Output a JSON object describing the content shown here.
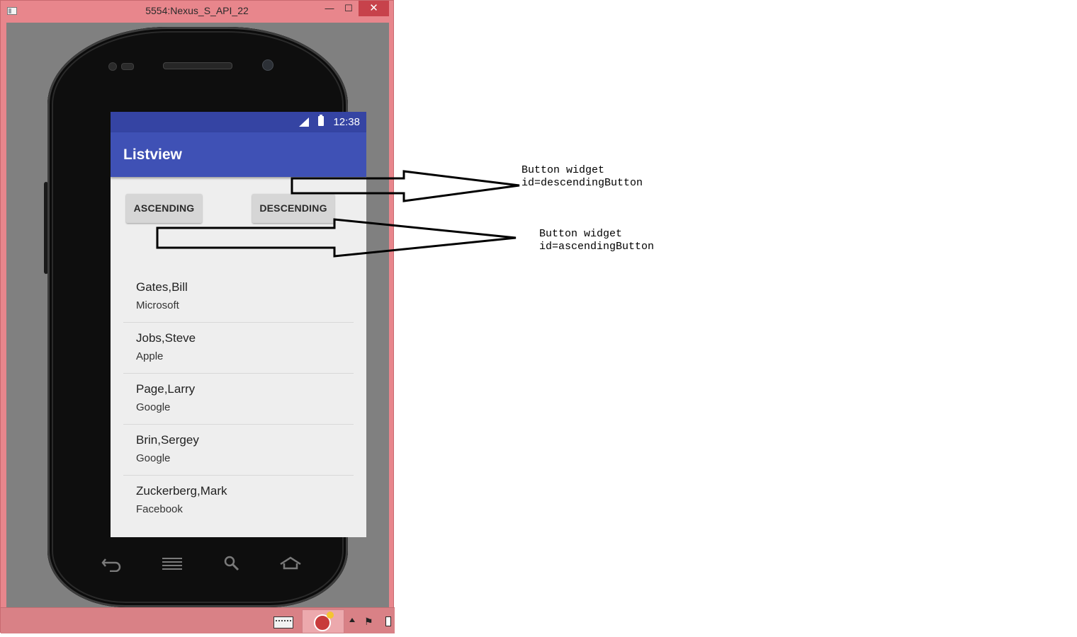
{
  "window": {
    "title": "5554:Nexus_S_API_22",
    "min_glyph": "—",
    "max_glyph": "☐",
    "close_glyph": "✕"
  },
  "phone": {
    "status_time": "12:38",
    "app_title": "Listview",
    "buttons": {
      "ascending": "ASCENDING",
      "descending": "DESCENDING"
    },
    "items": [
      {
        "name": "Gates,Bill",
        "company": "Microsoft"
      },
      {
        "name": "Jobs,Steve",
        "company": "Apple"
      },
      {
        "name": "Page,Larry",
        "company": "Google"
      },
      {
        "name": "Brin,Sergey",
        "company": "Google"
      },
      {
        "name": "Zuckerberg,Mark",
        "company": "Facebook"
      }
    ],
    "nav_icons": [
      "back-icon",
      "menu-icon",
      "search-icon",
      "home-icon"
    ]
  },
  "annotations": {
    "descending": {
      "line1": "Button widget",
      "line2": "id=descendingButton"
    },
    "ascending": {
      "line1": "Button widget",
      "line2": "id=ascendingButton"
    }
  },
  "colors": {
    "appbar": "#3f51b5",
    "statusbar": "#3544a3",
    "window_frame": "#e8868c",
    "close_button": "#c7424b"
  }
}
